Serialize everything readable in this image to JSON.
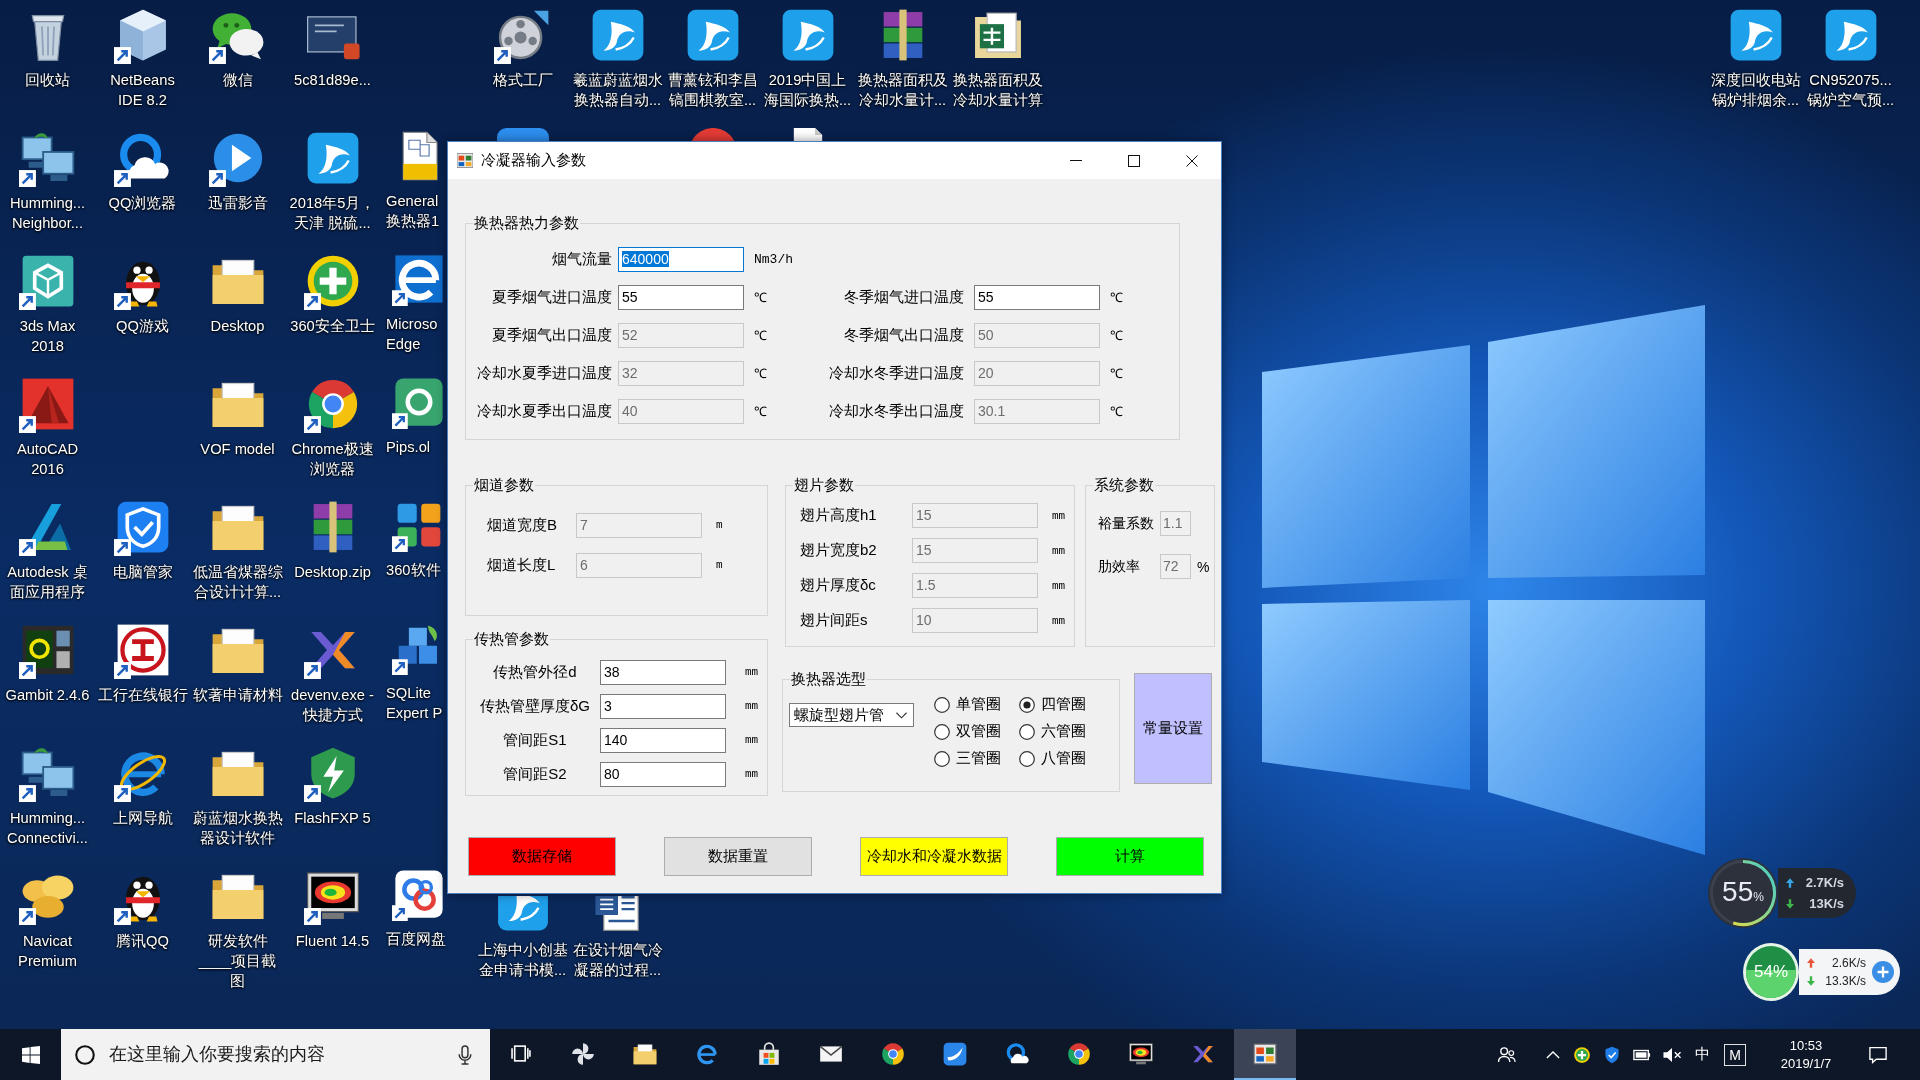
{
  "desktop": {
    "columns": [
      {
        "icons": [
          {
            "label": "回收站",
            "kind": "bin",
            "shortcut": false
          },
          {
            "label": "Humming... Neighbor...",
            "kind": "computers",
            "shortcut": true
          },
          {
            "label": "3ds Max 2018",
            "kind": "cube-tile",
            "shortcut": true
          },
          {
            "label": "AutoCAD 2016",
            "kind": "triangle-tile",
            "shortcut": true
          },
          {
            "label": "Autodesk 桌面应用程序",
            "kind": "peak",
            "shortcut": true
          },
          {
            "label": "Gambit 2.4.6",
            "kind": "grid-screen",
            "shortcut": true
          },
          {
            "label": "Humming... Connectivi...",
            "kind": "computers",
            "shortcut": true
          },
          {
            "label": "Navicat Premium",
            "kind": "petals",
            "shortcut": true
          }
        ]
      },
      {
        "icons": [
          {
            "label": "NetBeans IDE 8.2",
            "kind": "cube",
            "shortcut": true
          },
          {
            "label": "QQ浏览器",
            "kind": "ring-cloud",
            "shortcut": true
          },
          {
            "label": "QQ游戏",
            "kind": "penguin",
            "shortcut": true
          },
          {
            "label": "电脑管家",
            "kind": "shield-tile",
            "shortcut": true
          },
          {
            "label": "工行在线银行",
            "kind": "emblem",
            "shortcut": true
          },
          {
            "label": "上网导航",
            "kind": "browser-orbit",
            "shortcut": true
          },
          {
            "label": "腾讯QQ",
            "kind": "penguin",
            "shortcut": true
          }
        ]
      },
      {
        "icons": [
          {
            "label": "微信",
            "kind": "chat",
            "shortcut": true
          },
          {
            "label": "迅雷影音",
            "kind": "play",
            "shortcut": true
          },
          {
            "label": "Desktop",
            "kind": "folder",
            "shortcut": false
          },
          {
            "label": "VOF model",
            "kind": "folder",
            "shortcut": false
          },
          {
            "label": "低温省煤器综合设计计算...",
            "kind": "folder",
            "shortcut": false
          },
          {
            "label": "软著申请材料",
            "kind": "folder",
            "shortcut": false
          },
          {
            "label": "蔚蓝烟水换热器设计软件",
            "kind": "folder",
            "shortcut": false
          },
          {
            "label": "研发软件____项目截图",
            "kind": "folder",
            "shortcut": false
          }
        ]
      },
      {
        "icons": [
          {
            "label": "5c81d89e...",
            "kind": "slide",
            "shortcut": false
          },
          {
            "label": "2018年5月，天津 脱硫...",
            "kind": "swirl-tile",
            "shortcut": false
          },
          {
            "label": "360安全卫士",
            "kind": "plus-ball",
            "shortcut": true
          },
          {
            "label": "Chrome极速浏览器",
            "kind": "segmented",
            "shortcut": true
          },
          {
            "label": "Desktop.zip",
            "kind": "archive",
            "shortcut": false
          },
          {
            "label": "devenv.exe - 快捷方式",
            "kind": "cross",
            "shortcut": true
          },
          {
            "label": "FlashFXP 5",
            "kind": "lightning",
            "shortcut": true
          },
          {
            "label": "Fluent 14.5",
            "kind": "monitor",
            "shortcut": true
          }
        ]
      },
      {
        "icons": [
          {
            "label": "General 换热器1",
            "kind": "drawing-file",
            "shortcut": false
          },
          {
            "label": "Microso Edge",
            "kind": "browser-tile",
            "shortcut": true
          },
          {
            "label": "Pips.ol",
            "kind": "ring-tile",
            "shortcut": true
          },
          {
            "label": "360软件",
            "kind": "app-grid",
            "shortcut": true
          },
          {
            "label": "SQLite Expert P",
            "kind": "blocks",
            "shortcut": true
          },
          {
            "label": "百度网盘",
            "kind": "linked",
            "shortcut": true
          }
        ]
      },
      {
        "icons": [
          {
            "label": "格式工厂",
            "kind": "reel",
            "shortcut": true
          },
          {
            "kind": "tile-edge"
          },
          {
            "label": "上海中小创基金申请书模...",
            "kind": "swirl-tile",
            "shortcut": false
          }
        ]
      },
      {
        "icons": [
          {
            "label": "羲蓝蔚蓝烟水换热器自动...",
            "kind": "swirl-tile",
            "shortcut": false
          },
          {
            "label": "在设计烟气冷凝器的过程...",
            "kind": "document",
            "shortcut": false
          }
        ]
      },
      {
        "icons": [
          {
            "label": "曹薰铉和李昌镐围棋教室...",
            "kind": "swirl-tile",
            "shortcut": false
          },
          {
            "kind": "circle-edge"
          }
        ]
      },
      {
        "icons": [
          {
            "label": "2019中国上海国际换热...",
            "kind": "swirl-tile",
            "shortcut": false
          },
          {
            "kind": "page-edge"
          }
        ]
      },
      {
        "icons": [
          {
            "label": "换热器面积及冷却水量计...",
            "kind": "archive",
            "shortcut": false
          }
        ]
      },
      {
        "icons": [
          {
            "label": "换热器面积及冷却水量计算",
            "kind": "spreadsheet",
            "shortcut": false
          }
        ]
      }
    ],
    "right_columns": [
      {
        "icons": [
          {
            "label": "深度回收电站锅炉排烟余...",
            "kind": "swirl-tile",
            "shortcut": false
          }
        ]
      },
      {
        "icons": [
          {
            "label": "CN952075...锅炉空气预...",
            "kind": "swirl-tile",
            "shortcut": false
          }
        ]
      }
    ]
  },
  "dialog": {
    "title": "冷凝器输入参数",
    "thermal_group": {
      "title": "换热器热力参数",
      "summer_fields": [
        {
          "label": "烟气流量",
          "value": "640000",
          "unit": "Nm3/h",
          "disabled": false,
          "focused": true
        },
        {
          "label": "夏季烟气进口温度",
          "value": "55",
          "unit": "℃",
          "disabled": false,
          "focused": false
        },
        {
          "label": "夏季烟气出口温度",
          "value": "52",
          "unit": "℃",
          "disabled": true,
          "focused": false
        },
        {
          "label": "冷却水夏季进口温度",
          "value": "32",
          "unit": "℃",
          "disabled": true,
          "focused": false
        },
        {
          "label": "冷却水夏季出口温度",
          "value": "40",
          "unit": "℃",
          "disabled": true,
          "focused": false
        }
      ],
      "winter_fields": [
        {
          "label": "冬季烟气进口温度",
          "value": "55",
          "unit": "℃",
          "disabled": false,
          "focused": false
        },
        {
          "label": "冬季烟气出口温度",
          "value": "50",
          "unit": "℃",
          "disabled": true,
          "focused": false
        },
        {
          "label": "冷却水冬季进口温度",
          "value": "20",
          "unit": "℃",
          "disabled": true,
          "focused": false
        },
        {
          "label": "冷却水冬季出口温度",
          "value": "30.1",
          "unit": "℃",
          "disabled": true,
          "focused": false
        }
      ]
    },
    "flue_group": {
      "title": "烟道参数",
      "fields": [
        {
          "label": "烟道宽度B",
          "value": "7",
          "unit": "m",
          "disabled": true
        },
        {
          "label": "烟道长度L",
          "value": "6",
          "unit": "m",
          "disabled": true
        }
      ]
    },
    "tube_group": {
      "title": "传热管参数",
      "fields": [
        {
          "label": "传热管外径d",
          "value": "38",
          "unit": "mm",
          "disabled": false
        },
        {
          "label": "传热管壁厚度δG",
          "value": "3",
          "unit": "mm",
          "disabled": false
        },
        {
          "label": "管间距S1",
          "value": "140",
          "unit": "mm",
          "disabled": false
        },
        {
          "label": "管间距S2",
          "value": "80",
          "unit": "mm",
          "disabled": false
        }
      ]
    },
    "fin_group": {
      "title": "翅片参数",
      "fields": [
        {
          "label": "翅片高度h1",
          "value": "15",
          "unit": "mm",
          "disabled": true
        },
        {
          "label": "翅片宽度b2",
          "value": "15",
          "unit": "mm",
          "disabled": true
        },
        {
          "label": "翅片厚度δc",
          "value": "1.5",
          "unit": "mm",
          "disabled": true
        },
        {
          "label": "翅片间距s",
          "value": "10",
          "unit": "mm",
          "disabled": true
        }
      ]
    },
    "system_group": {
      "title": "系统参数",
      "fields": [
        {
          "label": "裕量系数",
          "value": "1.1",
          "disabled": true
        },
        {
          "label": "肋效率",
          "value": "72",
          "unit": "%",
          "disabled": true
        }
      ]
    },
    "type_group": {
      "title": "换热器选型",
      "dropdown": "螺旋型翅片管",
      "options": [
        {
          "label": "单管圈",
          "selected": false
        },
        {
          "label": "四管圈",
          "selected": true
        },
        {
          "label": "双管圈",
          "selected": false
        },
        {
          "label": "六管圈",
          "selected": false
        },
        {
          "label": "三管圈",
          "selected": false
        },
        {
          "label": "八管圈",
          "selected": false
        }
      ]
    },
    "constants_button": "常量设置",
    "buttons": [
      {
        "label": "数据存储",
        "color": "#ff0000"
      },
      {
        "label": "数据重置",
        "color": "#e1e1e1"
      },
      {
        "label": "冷却水和冷凝水数据",
        "color": "#ffff00"
      },
      {
        "label": "计算",
        "color": "#00ff00"
      }
    ]
  },
  "widgets": {
    "memory": {
      "reading": "55",
      "unit": "%",
      "level": 0.55,
      "upload": "2.7K/s",
      "download": "13K/s"
    },
    "speed_ball": {
      "reading": "54%",
      "level": 0.54,
      "upload": "2.6K/s",
      "download": "13.3K/s"
    }
  },
  "taskbar": {
    "search": {
      "placeholder": "在这里输入你要搜索的内容"
    },
    "apps": [
      {
        "kind": "pinwheel",
        "selected": false
      },
      {
        "kind": "folder",
        "selected": false
      },
      {
        "kind": "browser",
        "selected": false
      },
      {
        "kind": "bag",
        "selected": false
      },
      {
        "kind": "mail",
        "selected": false
      },
      {
        "kind": "segmented",
        "selected": false
      },
      {
        "kind": "swoosh-tile",
        "selected": false
      },
      {
        "kind": "ring-cloud",
        "selected": false
      },
      {
        "kind": "segmented",
        "selected": false
      },
      {
        "kind": "monitor",
        "selected": false
      },
      {
        "kind": "cross",
        "selected": false
      },
      {
        "kind": "app-window",
        "selected": true
      }
    ],
    "ime_language": "中",
    "ime_mode": "M",
    "time": "10:53",
    "date": "2019/1/7"
  }
}
